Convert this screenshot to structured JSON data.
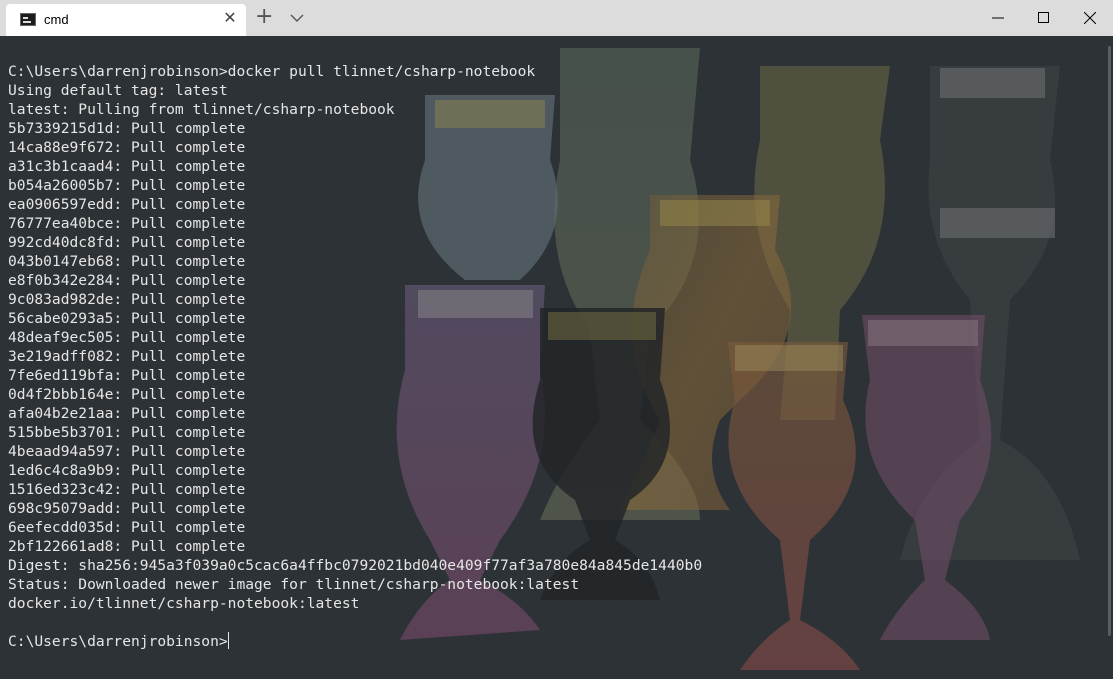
{
  "window": {
    "tab_title": "cmd",
    "tab_icon": "cmd-icon",
    "close_tab_icon": "close-icon",
    "new_tab_icon": "plus-icon",
    "dropdown_icon": "chevron-down-icon",
    "controls": [
      "minimize-icon",
      "maximize-icon",
      "close-icon"
    ]
  },
  "terminal": {
    "lines": [
      "",
      "C:\\Users\\darrenjrobinson>docker pull tlinnet/csharp-notebook",
      "Using default tag: latest",
      "latest: Pulling from tlinnet/csharp-notebook",
      "5b7339215d1d: Pull complete",
      "14ca88e9f672: Pull complete",
      "a31c3b1caad4: Pull complete",
      "b054a26005b7: Pull complete",
      "ea0906597edd: Pull complete",
      "76777ea40bce: Pull complete",
      "992cd40dc8fd: Pull complete",
      "043b0147eb68: Pull complete",
      "e8f0b342e284: Pull complete",
      "9c083ad982de: Pull complete",
      "56cabe0293a5: Pull complete",
      "48deaf9ec505: Pull complete",
      "3e219adff082: Pull complete",
      "7fe6ed119bfa: Pull complete",
      "0d4f2bbb164e: Pull complete",
      "afa04b2e21aa: Pull complete",
      "515bbe5b3701: Pull complete",
      "4beaad94a597: Pull complete",
      "1ed6c4c8a9b9: Pull complete",
      "1516ed323c42: Pull complete",
      "698c95079add: Pull complete",
      "6eefecdd035d: Pull complete",
      "2bf122661ad8: Pull complete",
      "Digest: sha256:945a3f039a0c5cac6a4ffbc0792021bd040e409f77af3a780e84a845de1440b0",
      "Status: Downloaded newer image for tlinnet/csharp-notebook:latest",
      "docker.io/tlinnet/csharp-notebook:latest",
      ""
    ],
    "prompt": "C:\\Users\\darrenjrobinson>",
    "colors": {
      "background": "#2d3236",
      "foreground": "#e6e6e6",
      "titlebar": "#dcdcdc"
    }
  }
}
